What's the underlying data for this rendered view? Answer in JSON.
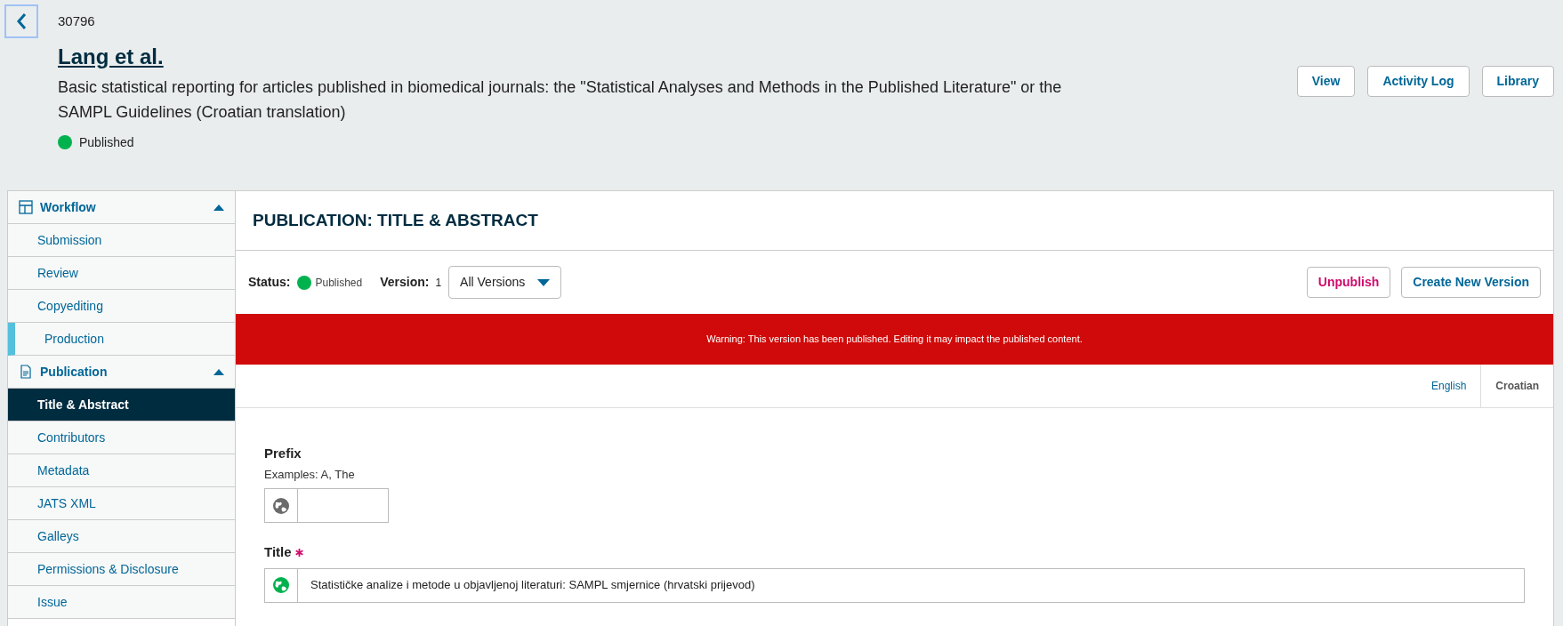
{
  "header": {
    "id": "30796",
    "author": "Lang et al.",
    "title": "Basic statistical reporting for articles published in biomedical journals: the \"Statistical Analyses and Methods in the Published Literature\" or the SAMPL Guidelines (Croatian translation)",
    "status": "Published",
    "buttons": [
      "View",
      "Activity Log",
      "Library"
    ]
  },
  "sidebar": [
    {
      "label": "Workflow",
      "expanded": true,
      "children": [
        {
          "label": "Submission",
          "selected": false,
          "current": false
        },
        {
          "label": "Review",
          "selected": false,
          "current": false
        },
        {
          "label": "Copyediting",
          "selected": false,
          "current": false
        },
        {
          "label": "Production",
          "selected": false,
          "current": true
        }
      ]
    },
    {
      "label": "Publication",
      "expanded": true,
      "children": [
        {
          "label": "Title & Abstract",
          "selected": true,
          "current": false
        },
        {
          "label": "Contributors",
          "selected": false,
          "current": false
        },
        {
          "label": "Metadata",
          "selected": false,
          "current": false
        },
        {
          "label": "JATS XML",
          "selected": false,
          "current": false
        },
        {
          "label": "Galleys",
          "selected": false,
          "current": false
        },
        {
          "label": "Permissions & Disclosure",
          "selected": false,
          "current": false
        },
        {
          "label": "Issue",
          "selected": false,
          "current": false
        }
      ]
    }
  ],
  "panel": {
    "heading": "PUBLICATION: TITLE & ABSTRACT",
    "status_label": "Status:",
    "status": "Published",
    "version_label": "Version:",
    "version": "1",
    "version_select": "All Versions",
    "actions": [
      {
        "label": "Unpublish",
        "kind": "danger"
      },
      {
        "label": "Create New Version",
        "kind": "default"
      }
    ],
    "warning": "Warning: This version has been published. Editing it may impact the published content.",
    "languages": [
      {
        "label": "English",
        "selected": false
      },
      {
        "label": "Croatian",
        "selected": true
      }
    ],
    "fields": [
      {
        "label": "Prefix",
        "required": false,
        "description": "Examples: A, The"
      },
      {
        "label": "Title",
        "required": true,
        "value": "Statističke analize i metode u objavljenoj literaturi: SAMPL smjernice (hrvatski prijevod)"
      }
    ]
  }
}
